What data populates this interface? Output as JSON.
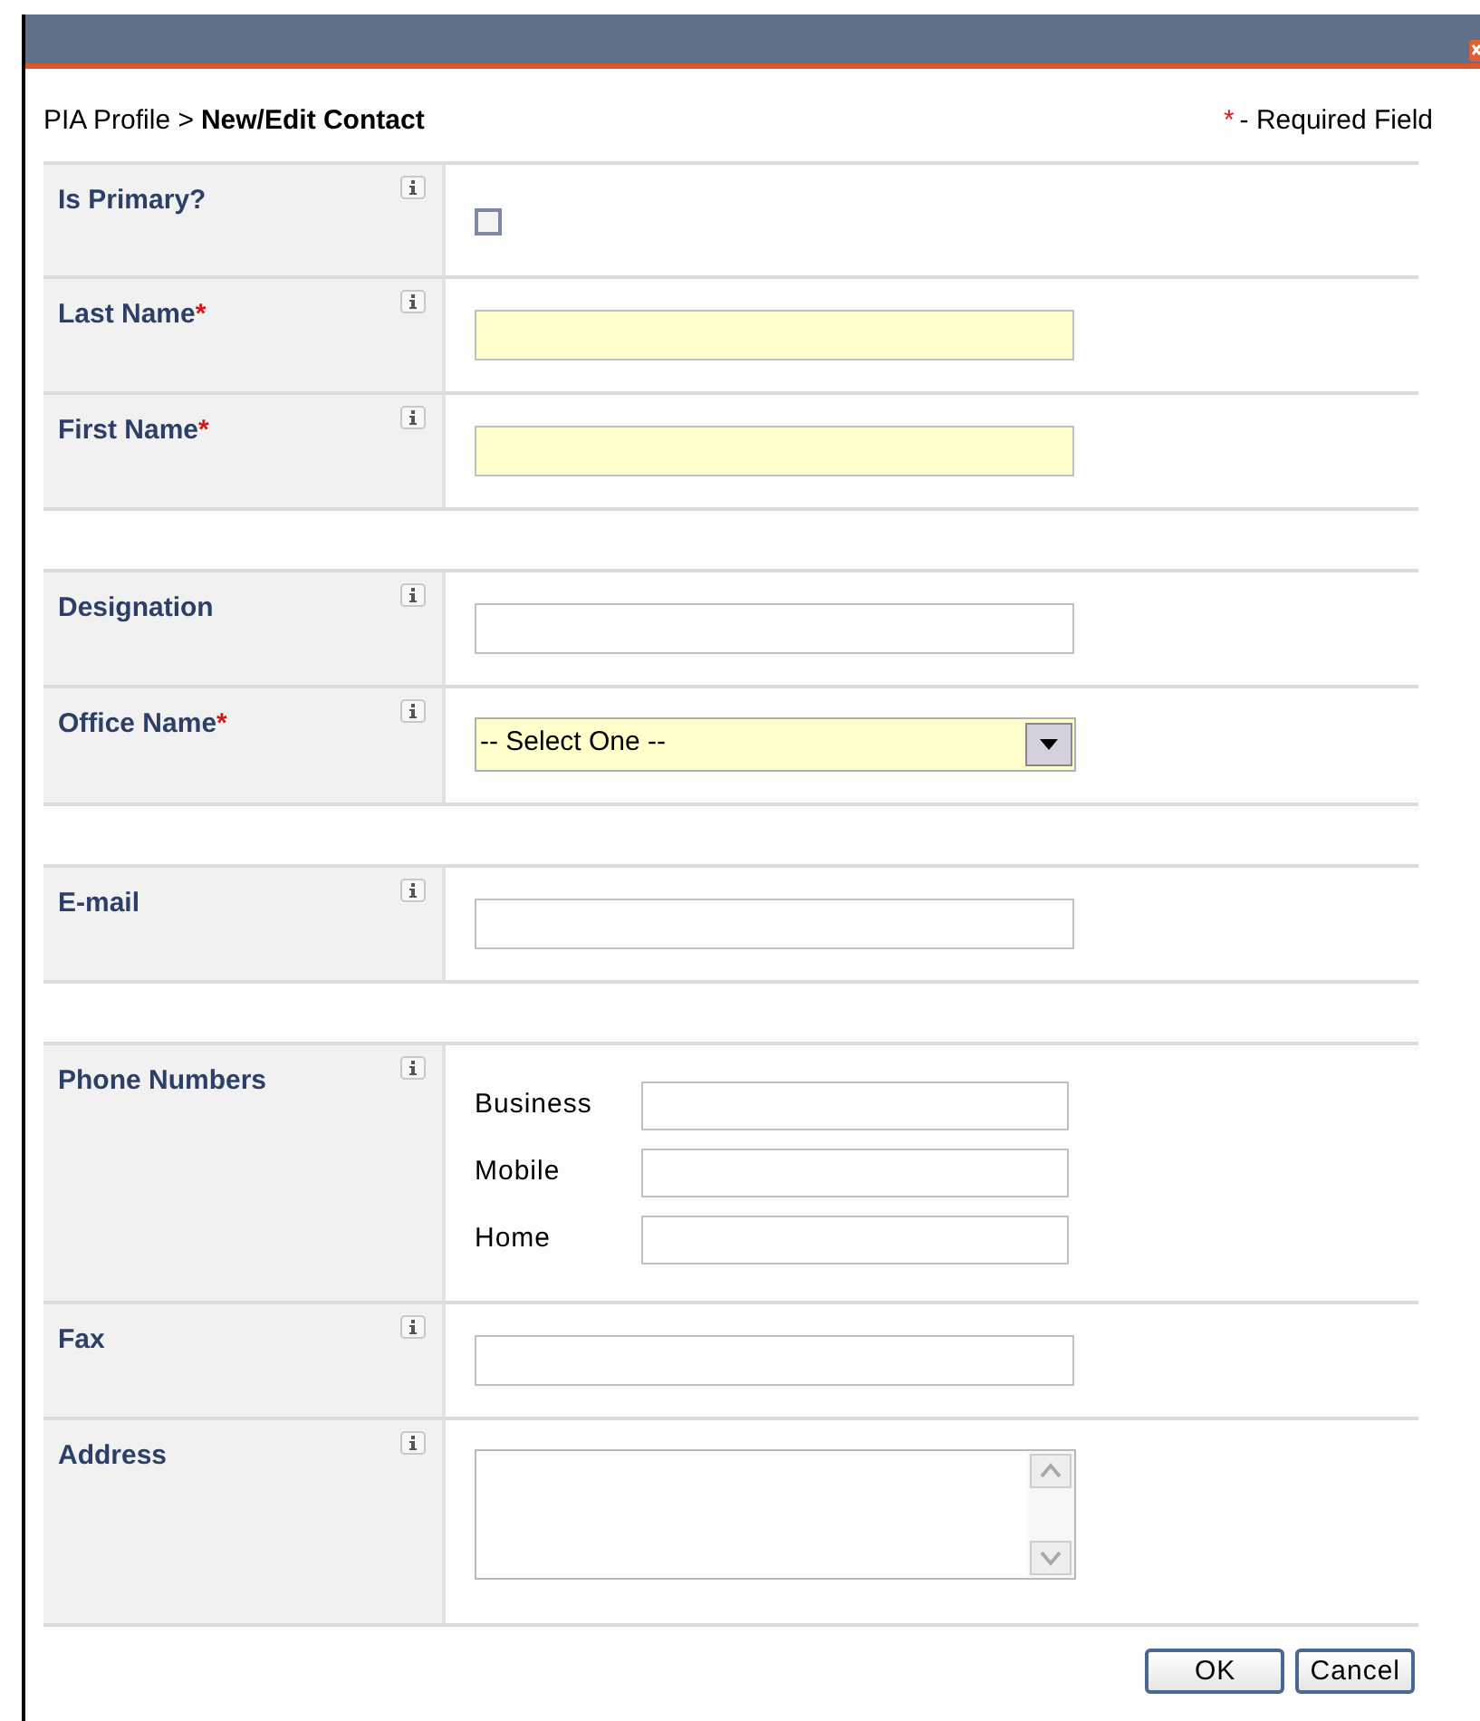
{
  "breadcrumb": {
    "parent": "PIA Profile >",
    "current": "New/Edit Contact"
  },
  "legend": {
    "mark": "*",
    "text": "- Required Field"
  },
  "sections": [
    [
      {
        "label": "Is Primary?",
        "kind": "checkbox",
        "checked": false
      },
      {
        "label": "Last Name",
        "mark": "*",
        "kind": "text",
        "required": true
      },
      {
        "label": "First Name",
        "mark": "*",
        "kind": "text",
        "required": true
      }
    ],
    [
      {
        "label": "Designation",
        "kind": "text",
        "required": false
      },
      {
        "label": "Office Name",
        "mark": "*",
        "kind": "select",
        "required": true,
        "value": "-- Select One --"
      }
    ],
    [
      {
        "label": "E-mail",
        "kind": "text",
        "required": false
      }
    ],
    [
      {
        "label": "Phone Numbers",
        "kind": "phones",
        "phones": [
          "Business",
          "Mobile",
          "Home"
        ]
      },
      {
        "label": "Fax",
        "kind": "text",
        "required": false
      },
      {
        "label": "Address",
        "kind": "textarea"
      }
    ]
  ],
  "buttons": [
    "OK",
    "Cancel"
  ]
}
